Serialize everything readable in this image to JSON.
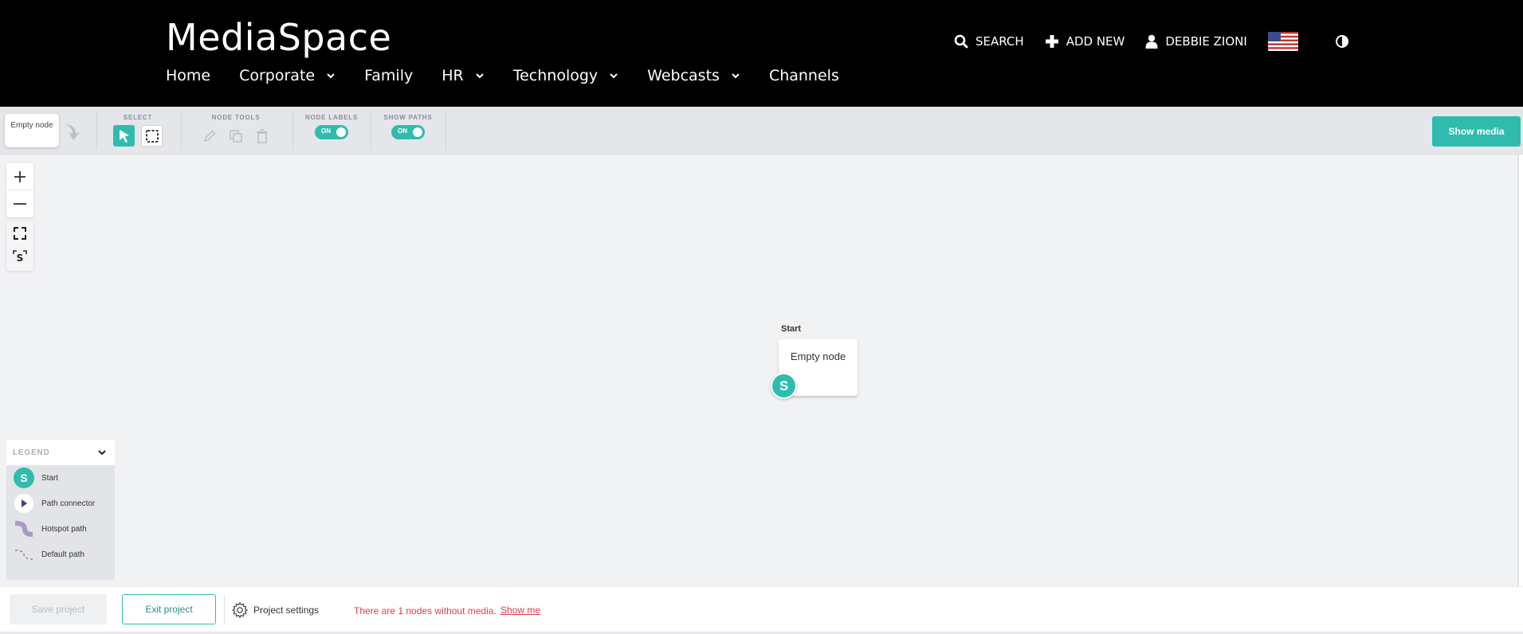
{
  "header": {
    "brand": "MediaSpace",
    "nav": [
      {
        "label": "Home",
        "dropdown": false
      },
      {
        "label": "Corporate",
        "dropdown": true
      },
      {
        "label": "Family",
        "dropdown": false
      },
      {
        "label": "HR",
        "dropdown": true
      },
      {
        "label": "Technology",
        "dropdown": true
      },
      {
        "label": "Webcasts",
        "dropdown": true
      },
      {
        "label": "Channels",
        "dropdown": false
      }
    ],
    "search_label": "SEARCH",
    "add_new_label": "ADD NEW",
    "user_name": "DEBBIE ZIONI"
  },
  "toolbar": {
    "node_chip": "Empty node",
    "select_label": "SELECT",
    "node_tools_label": "NODE TOOLS",
    "node_labels_label": "NODE LABELS",
    "node_labels_toggle": "ON",
    "show_paths_label": "SHOW PATHS",
    "show_paths_toggle": "ON",
    "show_media": "Show media"
  },
  "canvas": {
    "node_label": "Start",
    "node_text": "Empty node",
    "start_badge": "S",
    "zoom_s_label": "S"
  },
  "legend": {
    "title": "LEGEND",
    "items": [
      {
        "label": "Start",
        "icon": "start-icon",
        "badge": "S"
      },
      {
        "label": "Path connector",
        "icon": "path-connector-icon"
      },
      {
        "label": "Hotspot path",
        "icon": "hotspot-path-icon"
      },
      {
        "label": "Default path",
        "icon": "default-path-icon"
      }
    ]
  },
  "footer": {
    "save": "Save project",
    "exit": "Exit project",
    "settings": "Project settings",
    "warning": "There are 1 nodes without media.",
    "show_me": "Show me"
  },
  "colors": {
    "accent": "#2fbcae",
    "header_bg": "#000000",
    "warning": "#e03b4a",
    "hotspot_path": "#a99ac4"
  }
}
